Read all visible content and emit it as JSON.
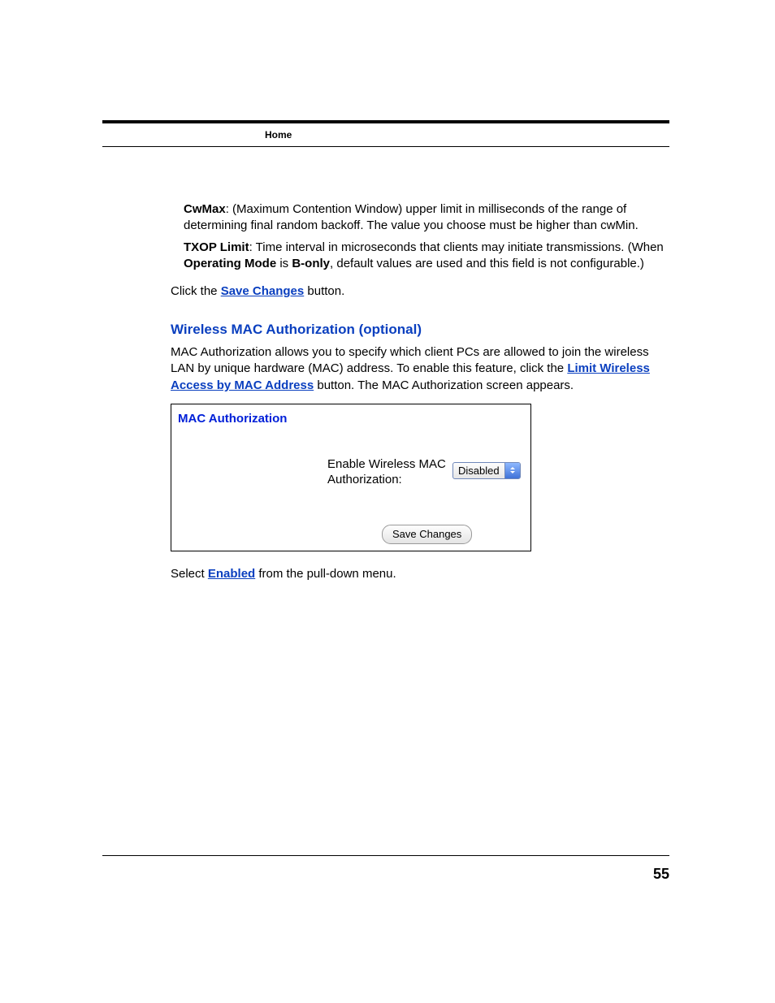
{
  "header": {
    "section": "Home"
  },
  "body": {
    "cwmax": {
      "term": "CwMax",
      "text": ": (Maximum Contention Window) upper limit in milliseconds of the range of determining final random backoff. The value you choose must be higher than cwMin."
    },
    "txop": {
      "term": "TXOP Limit",
      "text_before_mode": ": Time interval in microseconds that clients may initiate transmissions. (When ",
      "mode_label": "Operating Mode",
      "text_between": " is ",
      "mode_value": "B-only",
      "text_after": ", default values are used and this field is not configurable.)"
    },
    "click_save": {
      "before": "Click the ",
      "link": "Save Changes",
      "after": " button."
    },
    "heading": "Wireless MAC Authorization (optional)",
    "mac_intro": {
      "before": "MAC Authorization allows you to specify which client PCs are allowed to join the wireless LAN by unique hardware (MAC) address. To enable this feature, click the ",
      "link": "Limit Wireless Access by MAC Address",
      "after": " button. The MAC Authorization screen appears."
    },
    "figure": {
      "title": "MAC Authorization",
      "field_label": "Enable Wireless MAC Authorization:",
      "dropdown_value": "Disabled",
      "save_button": "Save Changes"
    },
    "select_enabled": {
      "before": "Select ",
      "link": "Enabled",
      "after": " from the pull-down menu."
    }
  },
  "page_number": "55"
}
